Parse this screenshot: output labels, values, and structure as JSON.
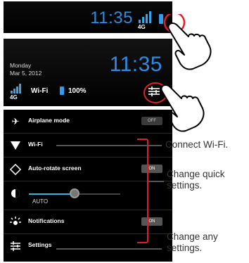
{
  "panel1": {
    "time": "11:35",
    "network": "4G"
  },
  "panel2": {
    "day": "Monday",
    "date": "Mar 5, 2012",
    "time": "11:35",
    "wifi_label": "Wi-Fi",
    "battery_pct": "100%"
  },
  "quick": {
    "airplane": {
      "label": "Airplane mode",
      "toggle": "OFF"
    },
    "wifi": {
      "label": "Wi-Fi"
    },
    "rotate": {
      "label": "Auto-rotate screen",
      "toggle": "ON"
    },
    "brightness": {
      "auto_label": "AUTO",
      "level": 0.5
    },
    "notifications": {
      "label": "Notifications",
      "toggle": "ON"
    },
    "settings": {
      "label": "Settings"
    }
  },
  "callouts": {
    "connect_wifi": "Connect Wi-Fi.",
    "change_quick_1": "Change quick",
    "change_quick_2": "settings.",
    "change_any_1": "Change any",
    "change_any_2": "settings."
  },
  "colors": {
    "accent": "#2e8ce6",
    "highlight": "#e02028"
  },
  "icons": [
    "signal-icon",
    "battery-icon",
    "hand-pointer-icon",
    "settings-sliders-icon",
    "airplane-icon",
    "wifi-icon",
    "rotate-icon",
    "brightness-icon",
    "notifications-icon"
  ]
}
